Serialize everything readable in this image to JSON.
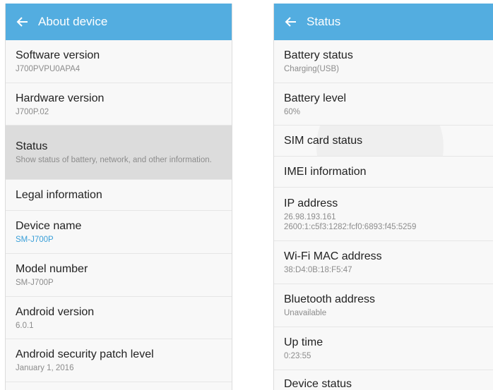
{
  "colors": {
    "appbar": "#53ade0",
    "accent_text": "#3a9fd8",
    "pressed_row": "#dcdcdc",
    "background": "#f8f8f8"
  },
  "about": {
    "title": "About device",
    "items": [
      {
        "title": "Software version",
        "sub": "J700PVPU0APA4"
      },
      {
        "title": "Hardware version",
        "sub": "J700P.02"
      },
      {
        "title": "Status",
        "sub": "Show status of battery, network, and other information."
      },
      {
        "title": "Legal information"
      },
      {
        "title": "Device name",
        "sub": "SM-J700P"
      },
      {
        "title": "Model number",
        "sub": "SM-J700P"
      },
      {
        "title": "Android version",
        "sub": "6.0.1"
      },
      {
        "title": "Android security patch level",
        "sub": "January 1, 2016"
      }
    ]
  },
  "status": {
    "title": "Status",
    "items": [
      {
        "title": "Battery status",
        "sub": "Charging(USB)"
      },
      {
        "title": "Battery level",
        "sub": "60%"
      },
      {
        "title": "SIM card status"
      },
      {
        "title": "IMEI information"
      },
      {
        "title": "IP address",
        "sub": "26.98.193.161",
        "sub2": "2600:1:c5f3:1282:fcf0:6893:f45:5259"
      },
      {
        "title": "Wi-Fi MAC address",
        "sub": "38:D4:0B:18:F5:47"
      },
      {
        "title": "Bluetooth address",
        "sub": "Unavailable"
      },
      {
        "title": "Up time",
        "sub": "0:23:55"
      },
      {
        "title": "Device status"
      }
    ]
  }
}
